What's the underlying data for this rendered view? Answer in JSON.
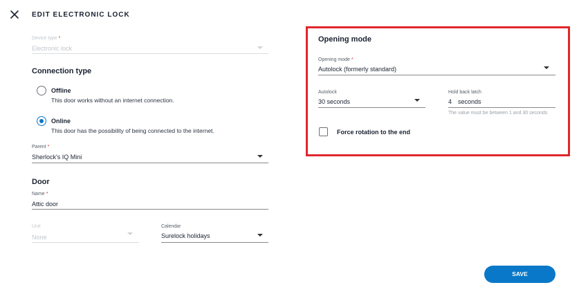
{
  "header": {
    "title": "EDIT ELECTRONIC LOCK"
  },
  "device_type": {
    "label": "Device type",
    "required": "*",
    "value": "Electronic lock"
  },
  "connection": {
    "title": "Connection type",
    "options": [
      {
        "title": "Offline",
        "description": "This door works without an internet connection.",
        "checked": false
      },
      {
        "title": "Online",
        "description": "This door has the possibility of being connected to the internet.",
        "checked": true
      }
    ]
  },
  "parent": {
    "label": "Parent",
    "required": "*",
    "value": "Sherlock's IQ Mini"
  },
  "door": {
    "title": "Door",
    "name_label": "Name",
    "name_required": "*",
    "name_value": "Attic door",
    "unit_label": "Unit",
    "unit_value": "None",
    "calendar_label": "Calendar",
    "calendar_value": "Surelock holidays"
  },
  "opening": {
    "title": "Opening mode",
    "mode_label": "Opening mode",
    "mode_required": "*",
    "mode_value": "Autolock (formerly standard)",
    "autolock_label": "Autolock",
    "autolock_value": "30 seconds",
    "latch_label": "Hold back latch",
    "latch_value": "4",
    "latch_unit": "seconds",
    "latch_hint": "The value must be between 1 and 30 seconds",
    "force_rotation_label": "Force rotation to the end",
    "force_rotation_checked": false
  },
  "actions": {
    "save_label": "SAVE"
  },
  "colors": {
    "accent": "#0a78c8",
    "highlight_border": "#e0262b",
    "required": "#d32f2f"
  },
  "icons": {
    "close": "close-icon",
    "dropdown": "chevron-down-icon"
  }
}
